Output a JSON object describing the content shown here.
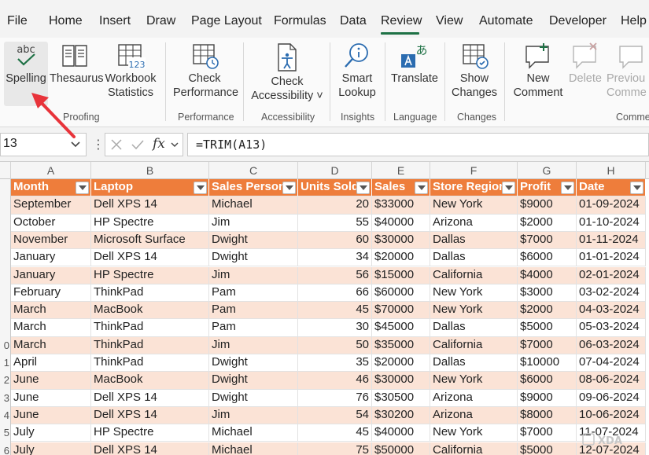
{
  "menu": {
    "tabs": [
      "File",
      "Home",
      "Insert",
      "Draw",
      "Page Layout",
      "Formulas",
      "Data",
      "Review",
      "View",
      "Automate",
      "Developer",
      "Help"
    ],
    "active": "Review"
  },
  "ribbon": {
    "proofing": {
      "label": "Proofing",
      "spelling": "Spelling",
      "thesaurus": "Thesaurus",
      "workbook_stats_1": "Workbook",
      "workbook_stats_2": "Statistics"
    },
    "performance": {
      "label": "Performance",
      "check_1": "Check",
      "check_2": "Performance"
    },
    "accessibility": {
      "label": "Accessibility",
      "check_1": "Check",
      "check_2": "Accessibility ˅"
    },
    "insights": {
      "label": "Insights",
      "smart_1": "Smart",
      "smart_2": "Lookup"
    },
    "language": {
      "label": "Language",
      "translate": "Translate"
    },
    "changes": {
      "label": "Changes",
      "show_1": "Show",
      "show_2": "Changes"
    },
    "comments": {
      "label": "Comme",
      "new_1": "New",
      "new_2": "Comment",
      "delete": "Delete",
      "previous_1": "Previou",
      "previous_2": "Comme"
    },
    "icon_texts": {
      "abc": "abc",
      "num": "123",
      "translate_glyph": "あ"
    }
  },
  "formula_bar": {
    "name_box": "13",
    "fx_label": "fx",
    "formula": "=TRIM(A13)"
  },
  "sheet": {
    "columns": [
      "A",
      "B",
      "C",
      "D",
      "E",
      "F",
      "G",
      "H"
    ],
    "headers": [
      "Month",
      "Laptop",
      "Sales Person",
      "Units Sold",
      "Sales",
      "Store Region",
      "Profit",
      "Date"
    ],
    "row_numbers": [
      "",
      "",
      "",
      "",
      "",
      "",
      "",
      "",
      "0",
      "1",
      "2",
      "3",
      "4",
      "5",
      "6"
    ],
    "rows": [
      [
        "September",
        "Dell XPS 14",
        "Michael",
        "20",
        "$33000",
        "New York",
        "$9000",
        "01-09-2024"
      ],
      [
        "October",
        "HP Spectre",
        "Jim",
        "55",
        "$40000",
        "Arizona",
        "$2000",
        "01-10-2024"
      ],
      [
        "November",
        "Microsoft Surface",
        "Dwight",
        "60",
        "$30000",
        "Dallas",
        "$7000",
        "01-11-2024"
      ],
      [
        "January",
        "Dell XPS 14",
        "Dwight",
        "34",
        "$20000",
        "Dallas",
        "$6000",
        "01-01-2024"
      ],
      [
        "January",
        "HP Spectre",
        "Jim",
        "56",
        "$15000",
        "California",
        "$4000",
        "02-01-2024"
      ],
      [
        "February",
        "ThinkPad",
        "Pam",
        "66",
        "$60000",
        "New York",
        "$3000",
        "03-02-2024"
      ],
      [
        "March",
        "MacBook",
        "Pam",
        "45",
        "$70000",
        "New York",
        "$2000",
        "04-03-2024"
      ],
      [
        "March",
        "ThinkPad",
        "Pam",
        "30",
        "$45000",
        "Dallas",
        "$5000",
        "05-03-2024"
      ],
      [
        "March",
        "ThinkPad",
        "Jim",
        "50",
        "$35000",
        "California",
        "$7000",
        "06-03-2024"
      ],
      [
        "April",
        "ThinkPad",
        "Dwight",
        "35",
        "$20000",
        "Dallas",
        "$10000",
        "07-04-2024"
      ],
      [
        "June",
        "MacBook",
        "Dwight",
        "46",
        "$30000",
        "New York",
        "$6000",
        "08-06-2024"
      ],
      [
        "June",
        "Dell XPS 14",
        "Dwight",
        "76",
        "$30500",
        "Arizona",
        "$9000",
        "09-06-2024"
      ],
      [
        "June",
        "Dell XPS 14",
        "Jim",
        "54",
        "$30200",
        "Arizona",
        "$8000",
        "10-06-2024"
      ],
      [
        "July",
        "HP Spectre",
        "Michael",
        "45",
        "$40000",
        "New York",
        "$7000",
        "11-07-2024"
      ],
      [
        "July",
        "Dell XPS 14",
        "Michael",
        "75",
        "$50000",
        "California",
        "$5000",
        "12-07-2024"
      ]
    ]
  },
  "watermark": "XDA",
  "colors": {
    "header_fill": "#ee7d3b",
    "band_fill": "#fbe3d6",
    "accent_green": "#1e7145",
    "arrow_red": "#e8333a"
  },
  "icons": [
    "spelling-icon",
    "thesaurus-icon",
    "workbook-statistics-icon",
    "check-performance-icon",
    "check-accessibility-icon",
    "smart-lookup-icon",
    "translate-icon",
    "show-changes-icon",
    "new-comment-icon",
    "delete-comment-icon",
    "previous-comment-icon",
    "filter-icon",
    "chevron-down-icon",
    "cancel-icon",
    "enter-icon"
  ]
}
